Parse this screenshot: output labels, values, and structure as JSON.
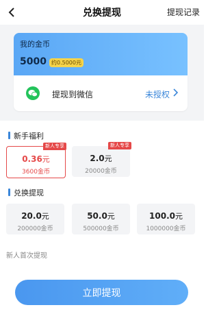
{
  "header": {
    "title": "兑换提现",
    "history_label": "提现记录"
  },
  "coin_card": {
    "title": "我的金币",
    "amount": "5000",
    "approx": "约0.5000元"
  },
  "wechat": {
    "label": "提现到微信",
    "status": "未授权"
  },
  "newbie": {
    "title": "新手福利",
    "options": [
      {
        "price": "0.36",
        "unit": "元",
        "coins": "3600金币",
        "tag": "新人专享",
        "selected": true
      },
      {
        "price": "2.0",
        "unit": "元",
        "coins": "20000金币",
        "tag": "新人专享",
        "selected": false
      }
    ]
  },
  "exchange": {
    "title": "兑换提现",
    "options": [
      {
        "price": "20.0",
        "unit": "元",
        "coins": "200000金币"
      },
      {
        "price": "50.0",
        "unit": "元",
        "coins": "500000金币"
      },
      {
        "price": "100.0",
        "unit": "元",
        "coins": "1000000金币"
      }
    ]
  },
  "note": "新人首次提现",
  "submit_label": "立即提现",
  "colors": {
    "accent": "#3a86d9",
    "selected": "#e54848",
    "wechat": "#23c35b",
    "badge": "#f6d44a"
  }
}
